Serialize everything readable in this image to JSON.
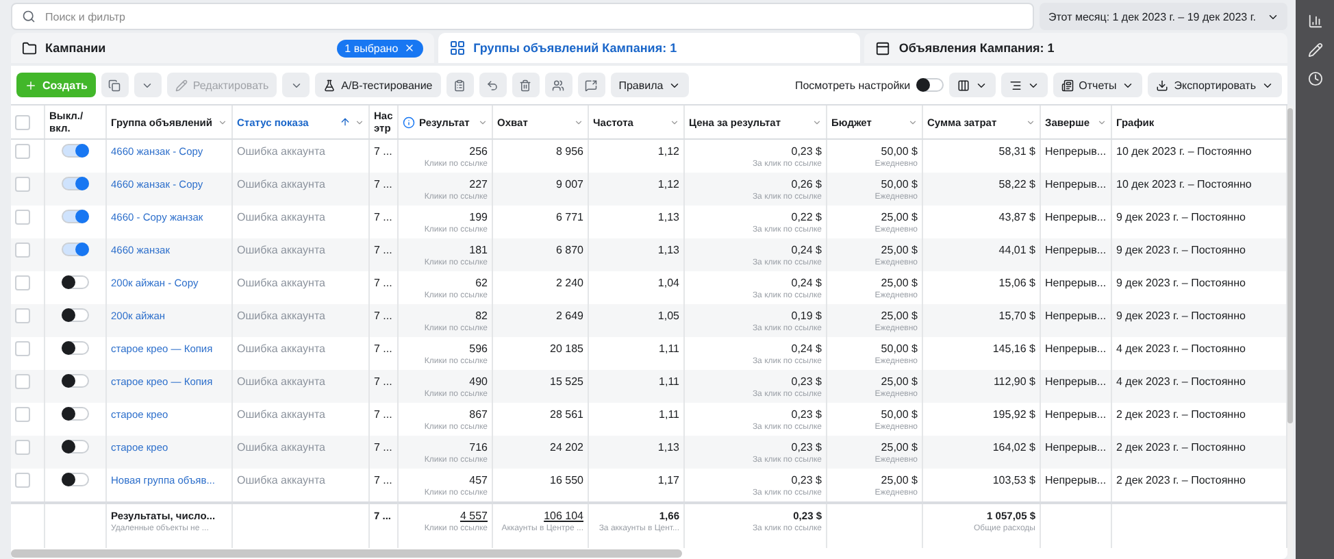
{
  "search": {
    "placeholder": "Поиск и фильтр"
  },
  "date_range": "Этот месяц: 1 дек 2023 г. – 19 дек 2023 г.",
  "tabs": [
    {
      "kind": "campaigns",
      "label": "Кампании",
      "badge": "1 выбрано",
      "selected": false
    },
    {
      "kind": "adsets",
      "label": "Группы объявлений Кампания: 1",
      "selected": true
    },
    {
      "kind": "ads",
      "label": "Объявления Кампания: 1",
      "selected": false
    }
  ],
  "toolbar": {
    "create": "Создать",
    "edit": {
      "label": "Редактировать",
      "disabled": true
    },
    "ab_test": "A/B-тестирование",
    "rules": "Правила",
    "view_settings": {
      "label": "Посмотреть настройки",
      "on": false
    },
    "reports": "Отчеты",
    "export": "Экспортировать"
  },
  "table": {
    "select_all_checked": false,
    "columns": [
      {
        "label": "Выкл./вкл.",
        "menu": false
      },
      {
        "label": "Группа объявлений",
        "menu": true
      },
      {
        "label": "Статус показа",
        "menu": true,
        "sorted": true
      },
      {
        "label": "Нас этр"
      },
      {
        "label": "Результат",
        "menu": true,
        "info": true
      },
      {
        "label": "Охват",
        "menu": true
      },
      {
        "label": "Частота",
        "menu": true
      },
      {
        "label": "Цена за результат",
        "menu": true
      },
      {
        "label": "Бюджет",
        "menu": true
      },
      {
        "label": "Сумма затрат",
        "menu": true
      },
      {
        "label": "Заверше",
        "menu": true
      },
      {
        "label": "График",
        "menu": false
      }
    ],
    "rows": [
      {
        "checked": false,
        "on": true,
        "name": "4660 жанзак - Copy",
        "status": "Ошибка аккаунта",
        "column_5": "7 ...",
        "result": "256",
        "result_note": "Клики по ссылке",
        "reach": "8 956",
        "frequency": "1,12",
        "cost": "0,23 $",
        "cost_note": "За клик по ссылке",
        "budget": "50,00 $",
        "budget_note": "Ежедневно",
        "spent": "58,31 $",
        "end": "Непрерыв...",
        "schedule": "10 дек 2023 г. – Постоянно"
      },
      {
        "checked": false,
        "on": true,
        "name": "4660 жанзак - Copy",
        "status": "Ошибка аккаунта",
        "column_5": "7 ...",
        "result": "227",
        "result_note": "Клики по ссылке",
        "reach": "9 007",
        "frequency": "1,12",
        "cost": "0,26 $",
        "cost_note": "За клик по ссылке",
        "budget": "50,00 $",
        "budget_note": "Ежедневно",
        "spent": "58,22 $",
        "end": "Непрерыв...",
        "schedule": "10 дек 2023 г. – Постоянно"
      },
      {
        "checked": false,
        "on": true,
        "name": "4660 - Copy жанзак",
        "status": "Ошибка аккаунта",
        "column_5": "7 ...",
        "result": "199",
        "result_note": "Клики по ссылке",
        "reach": "6 771",
        "frequency": "1,13",
        "cost": "0,22 $",
        "cost_note": "За клик по ссылке",
        "budget": "25,00 $",
        "budget_note": "Ежедневно",
        "spent": "43,87 $",
        "end": "Непрерыв...",
        "schedule": "9 дек 2023 г. – Постоянно"
      },
      {
        "checked": false,
        "on": true,
        "name": "4660 жанзак",
        "status": "Ошибка аккаунта",
        "column_5": "7 ...",
        "result": "181",
        "result_note": "Клики по ссылке",
        "reach": "6 870",
        "frequency": "1,13",
        "cost": "0,24 $",
        "cost_note": "За клик по ссылке",
        "budget": "25,00 $",
        "budget_note": "Ежедневно",
        "spent": "44,01 $",
        "end": "Непрерыв...",
        "schedule": "9 дек 2023 г. – Постоянно"
      },
      {
        "checked": false,
        "on": false,
        "name": "200к айжан - Copy",
        "status": "Ошибка аккаунта",
        "column_5": "7 ...",
        "result": "62",
        "result_note": "Клики по ссылке",
        "reach": "2 240",
        "frequency": "1,04",
        "cost": "0,24 $",
        "cost_note": "За клик по ссылке",
        "budget": "25,00 $",
        "budget_note": "Ежедневно",
        "spent": "15,06 $",
        "end": "Непрерыв...",
        "schedule": "9 дек 2023 г. – Постоянно"
      },
      {
        "checked": false,
        "on": false,
        "name": "200к айжан",
        "status": "Ошибка аккаунта",
        "column_5": "7 ...",
        "result": "82",
        "result_note": "Клики по ссылке",
        "reach": "2 649",
        "frequency": "1,05",
        "cost": "0,19 $",
        "cost_note": "За клик по ссылке",
        "budget": "25,00 $",
        "budget_note": "Ежедневно",
        "spent": "15,70 $",
        "end": "Непрерыв...",
        "schedule": "9 дек 2023 г. – Постоянно"
      },
      {
        "checked": false,
        "on": false,
        "name": "старое крео — Копия",
        "status": "Ошибка аккаунта",
        "column_5": "7 ...",
        "result": "596",
        "result_note": "Клики по ссылке",
        "reach": "20 185",
        "frequency": "1,11",
        "cost": "0,24 $",
        "cost_note": "За клик по ссылке",
        "budget": "50,00 $",
        "budget_note": "Ежедневно",
        "spent": "145,16 $",
        "end": "Непрерыв...",
        "schedule": "4 дек 2023 г. – Постоянно"
      },
      {
        "checked": false,
        "on": false,
        "name": "старое крео — Копия",
        "status": "Ошибка аккаунта",
        "column_5": "7 ...",
        "result": "490",
        "result_note": "Клики по ссылке",
        "reach": "15 525",
        "frequency": "1,11",
        "cost": "0,23 $",
        "cost_note": "За клик по ссылке",
        "budget": "25,00 $",
        "budget_note": "Ежедневно",
        "spent": "112,90 $",
        "end": "Непрерыв...",
        "schedule": "4 дек 2023 г. – Постоянно"
      },
      {
        "checked": false,
        "on": false,
        "name": "старое крео",
        "status": "Ошибка аккаунта",
        "column_5": "7 ...",
        "result": "867",
        "result_note": "Клики по ссылке",
        "reach": "28 561",
        "frequency": "1,11",
        "cost": "0,23 $",
        "cost_note": "За клик по ссылке",
        "budget": "50,00 $",
        "budget_note": "Ежедневно",
        "spent": "195,92 $",
        "end": "Непрерыв...",
        "schedule": "2 дек 2023 г. – Постоянно"
      },
      {
        "checked": false,
        "on": false,
        "name": "старое крео",
        "status": "Ошибка аккаунта",
        "column_5": "7 ...",
        "result": "716",
        "result_note": "Клики по ссылке",
        "reach": "24 202",
        "frequency": "1,13",
        "cost": "0,23 $",
        "cost_note": "За клик по ссылке",
        "budget": "25,00 $",
        "budget_note": "Ежедневно",
        "spent": "164,02 $",
        "end": "Непрерыв...",
        "schedule": "2 дек 2023 г. – Постоянно"
      },
      {
        "checked": false,
        "on": false,
        "name": "Новая группа объяв...",
        "status": "Ошибка аккаунта",
        "column_5": "7 ...",
        "result": "457",
        "result_note": "Клики по ссылке",
        "reach": "16 550",
        "frequency": "1,17",
        "cost": "0,23 $",
        "cost_note": "За клик по ссылке",
        "budget": "25,00 $",
        "budget_note": "Ежедневно",
        "spent": "103,53 $",
        "end": "Непрерыв...",
        "schedule": "2 дек 2023 г. – Постоянно"
      }
    ],
    "totals": {
      "label": "Результаты, число...",
      "note": "Удаленные объекты не ...",
      "column_5": "7 ...",
      "result": "4 557",
      "result_note": "Клики по ссылке",
      "reach": "106 104",
      "reach_note": "Аккаунты в Центре ...",
      "frequency": "1,66",
      "frequency_note": "За аккаунты в Цент...",
      "cost": "0,23 $",
      "cost_note": "За клик по ссылке",
      "spent": "1 057,05 $",
      "spent_note": "Общие расходы"
    }
  }
}
